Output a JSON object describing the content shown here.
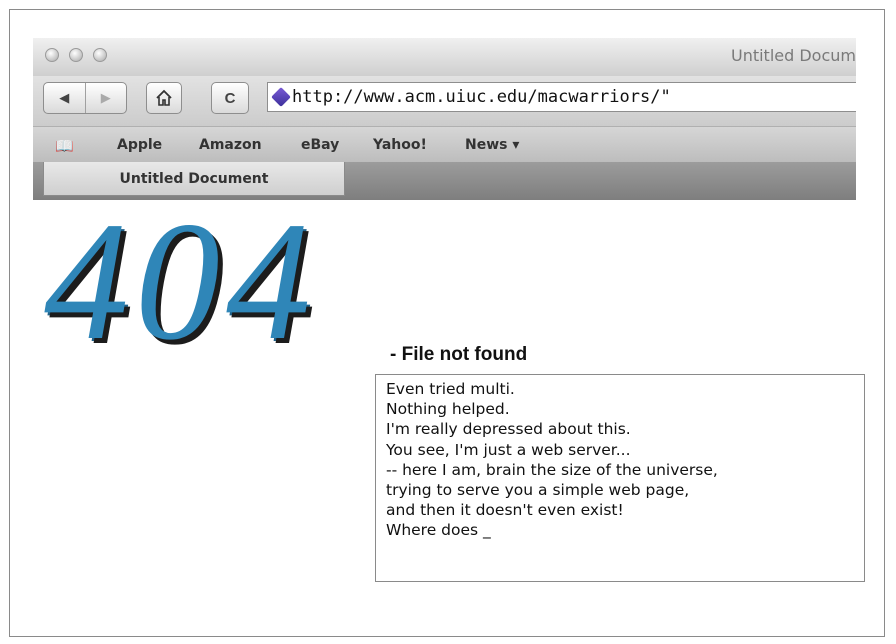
{
  "window": {
    "title": "Untitled Docum",
    "url": "http://www.acm.uiuc.edu/macwarriors/\""
  },
  "toolbar": {
    "back_glyph": "◀",
    "forward_glyph": "▶",
    "home_icon": "home-icon",
    "reload_glyph": "C"
  },
  "bookmarks": {
    "book_icon": "📖",
    "items": [
      "Apple",
      "Amazon",
      "eBay",
      "Yahoo!",
      "News ▾"
    ]
  },
  "tab": {
    "label": "Untitled Document"
  },
  "page": {
    "error_code": "404",
    "subtitle": "- File not found",
    "lines": [
      "Even tried multi.",
      "Nothing helped.",
      "I'm really depressed about this.",
      "You see, I'm just a web server...",
      "-- here I am, brain the size of the universe,",
      "trying to serve you a simple web page,",
      "and then it doesn't even exist!",
      "Where does _"
    ]
  },
  "colors": {
    "error_code": "#2f86b8",
    "error_shadow": "#1c1c1c"
  }
}
